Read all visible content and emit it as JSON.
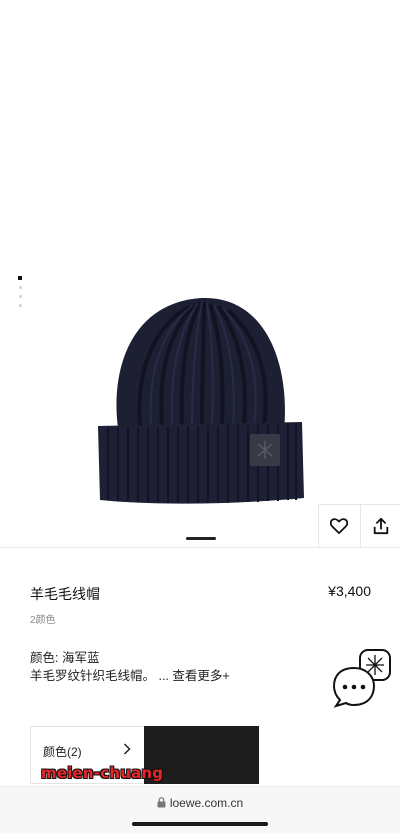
{
  "product": {
    "title": "羊毛毛线帽",
    "price": "¥3,400",
    "colors_count": "2颜色",
    "color_line": "颜色: 海军蓝",
    "description": "羊毛罗纹针织毛线帽。 ...",
    "more_label": "查看更多+"
  },
  "gallery": {
    "image_icon": "beanie-hat-image",
    "dot_count": 5,
    "active_index": 0
  },
  "actions": {
    "wishlist_icon": "heart-icon",
    "share_icon": "share-icon"
  },
  "color_selector": {
    "label": "颜色(2)",
    "swatch_color": "#1d1d1d"
  },
  "chat": {
    "icon": "chat-bubbles-icon"
  },
  "watermark": {
    "text": "meien-chuang"
  },
  "browser": {
    "url": "loewe.com.cn",
    "lock_icon": "lock-icon"
  },
  "colors": {
    "hat_navy": "#1a1c2e",
    "accent": "#111111",
    "watermark": "#e8262a"
  }
}
